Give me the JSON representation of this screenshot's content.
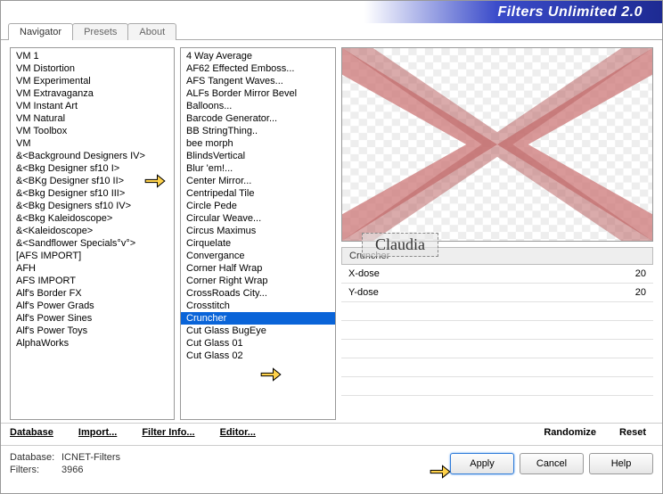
{
  "title": "Filters Unlimited 2.0",
  "tabs": [
    "Navigator",
    "Presets",
    "About"
  ],
  "activeTab": 0,
  "list1": [
    "VM 1",
    "VM Distortion",
    "VM Experimental",
    "VM Extravaganza",
    "VM Instant Art",
    "VM Natural",
    "VM Toolbox",
    "VM",
    "&<Background Designers IV>",
    "&<Bkg Designer sf10 I>",
    "&<BKg Designer sf10 II>",
    "&<Bkg Designer sf10 III>",
    "&<Bkg Designers sf10 IV>",
    "&<Bkg Kaleidoscope>",
    "&<Kaleidoscope>",
    "&<Sandflower Specials°v°>",
    "[AFS IMPORT]",
    "AFH",
    "AFS IMPORT",
    "Alf's Border FX",
    "Alf's Power Grads",
    "Alf's Power Sines",
    "Alf's Power Toys",
    "AlphaWorks"
  ],
  "list2": [
    "4 Way Average",
    "AF62 Effected Emboss...",
    "AFS Tangent Waves...",
    "ALFs Border Mirror Bevel",
    "Balloons...",
    "Barcode Generator...",
    "BB StringThing..",
    "bee morph",
    "BlindsVertical",
    "Blur 'em!...",
    "Center Mirror...",
    "Centripedal Tile",
    "Circle Pede",
    "Circular Weave...",
    "Circus Maximus",
    "Cirquelate",
    "Convergance",
    "Corner Half Wrap",
    "Corner Right Wrap",
    "CrossRoads City...",
    "Crosstitch",
    "Cruncher",
    "Cut Glass  BugEye",
    "Cut Glass 01",
    "Cut Glass 02"
  ],
  "list2SelectedIndex": 21,
  "paramTitle": "Cruncher",
  "params": [
    {
      "name": "X-dose",
      "value": "20"
    },
    {
      "name": "Y-dose",
      "value": "20"
    }
  ],
  "toolbar": {
    "database": "Database",
    "import": "Import...",
    "filterInfo": "Filter Info...",
    "editor": "Editor...",
    "randomize": "Randomize",
    "reset": "Reset"
  },
  "meta": {
    "dbLabel": "Database:",
    "dbValue": "ICNET-Filters",
    "filtLabel": "Filters:",
    "filtValue": "3966"
  },
  "buttons": {
    "apply": "Apply",
    "cancel": "Cancel",
    "help": "Help"
  },
  "watermark": "Claudia"
}
